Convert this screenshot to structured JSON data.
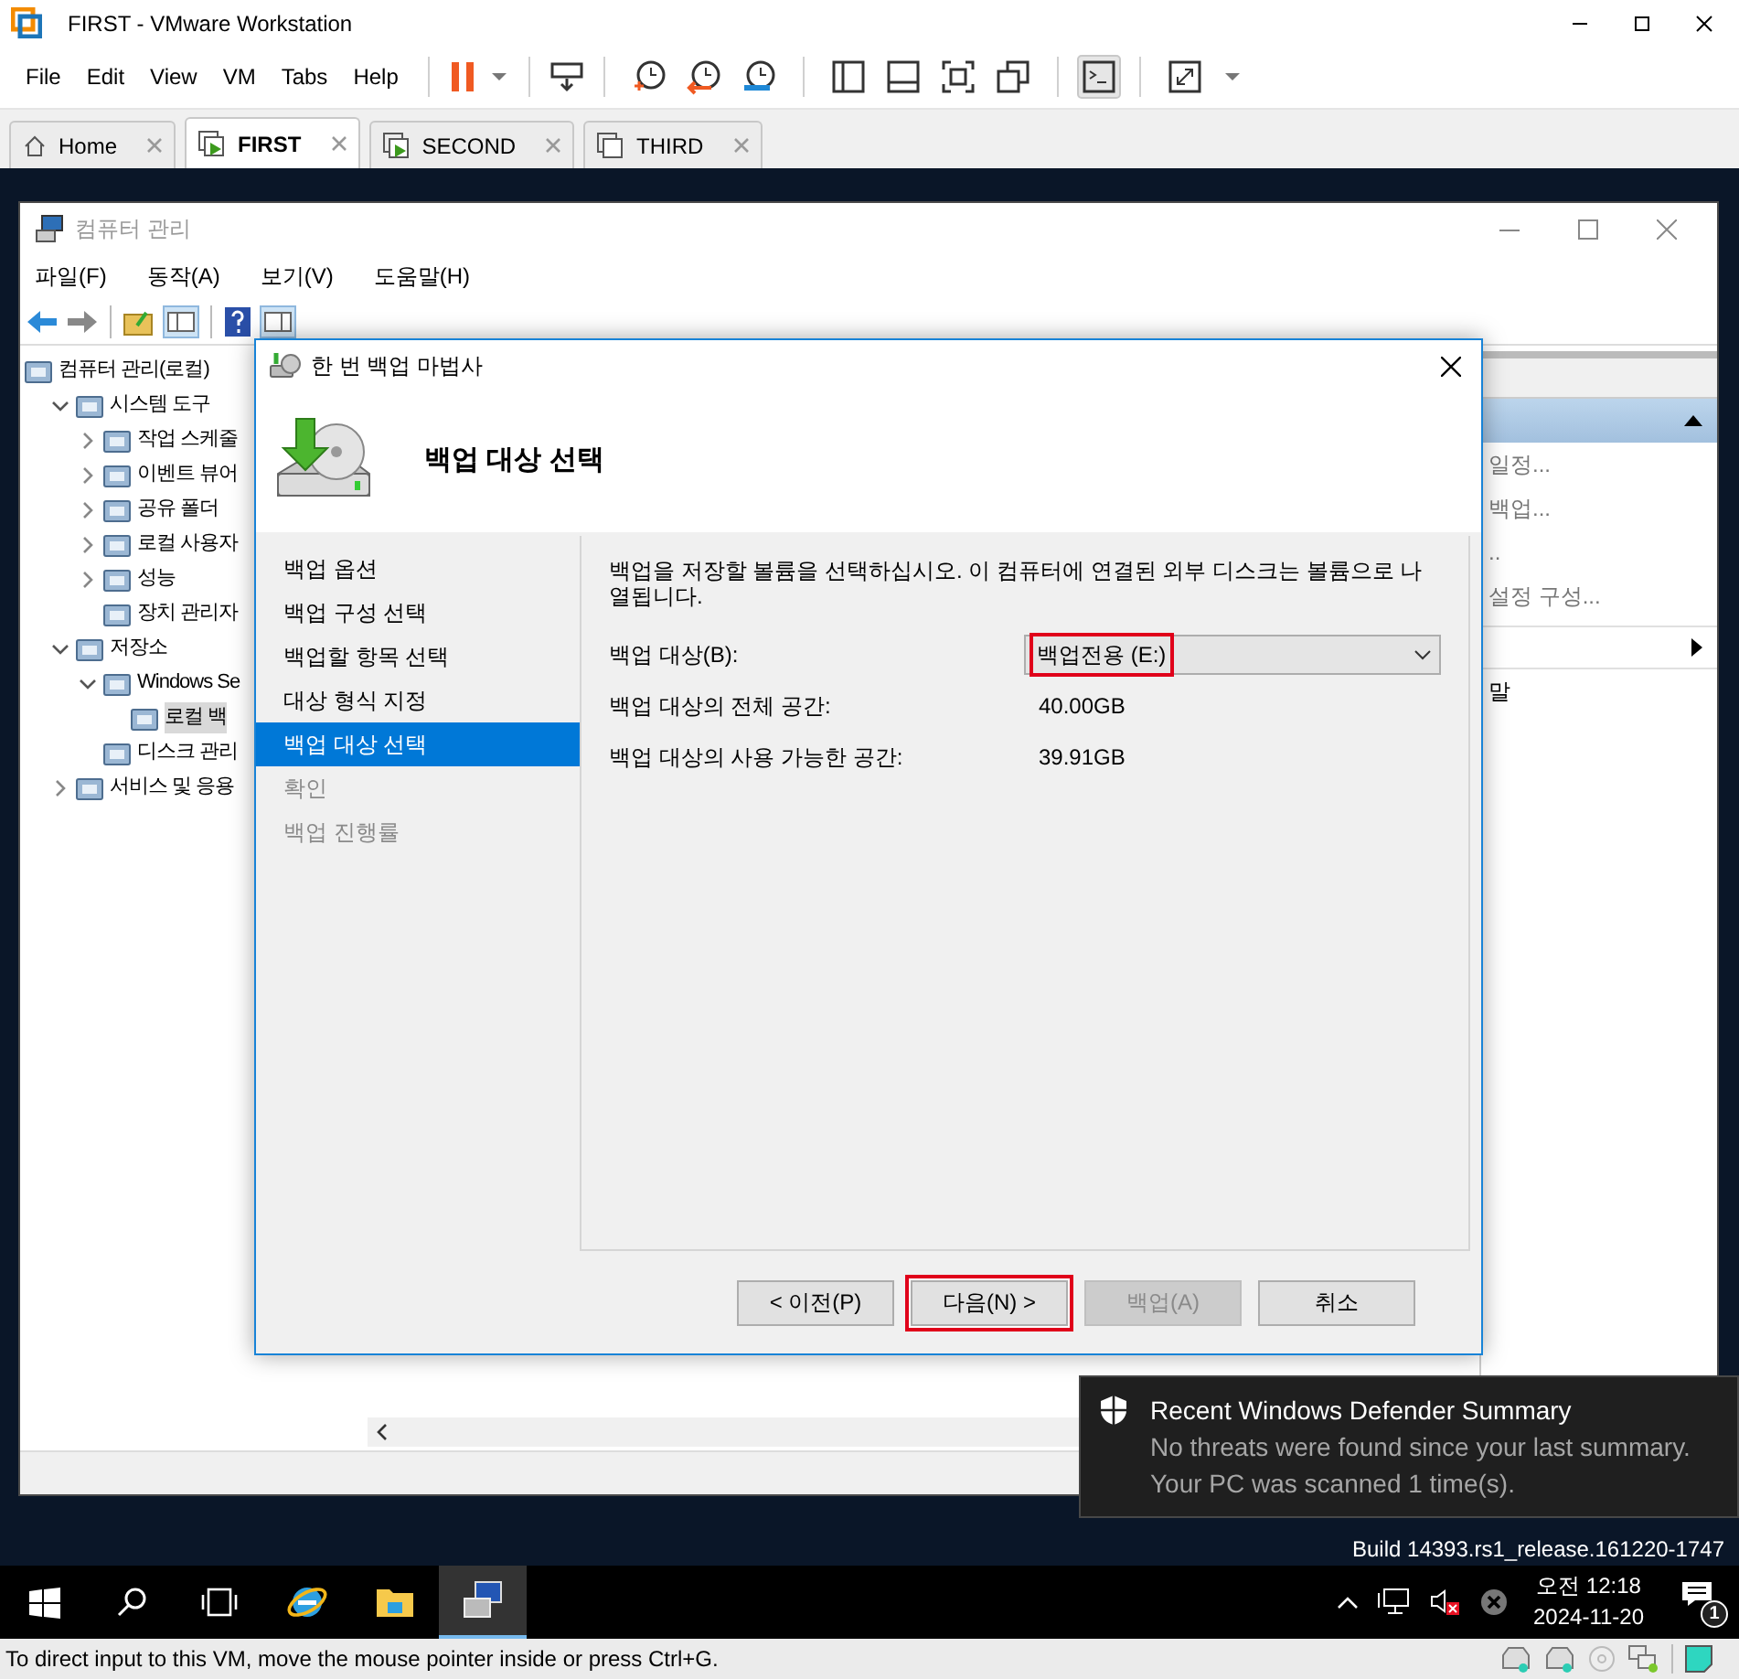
{
  "vmware": {
    "title": "FIRST - VMware Workstation",
    "menu": [
      "File",
      "Edit",
      "View",
      "VM",
      "Tabs",
      "Help"
    ],
    "tabs": [
      {
        "label": "Home",
        "selected": false
      },
      {
        "label": "FIRST",
        "selected": true
      },
      {
        "label": "SECOND",
        "selected": false
      },
      {
        "label": "THIRD",
        "selected": false
      }
    ]
  },
  "guest": {
    "computer_management": {
      "title": "컴퓨터 관리",
      "menu": [
        "파일(F)",
        "동작(A)",
        "보기(V)",
        "도움말(H)"
      ],
      "tree": [
        {
          "label": "컴퓨터 관리(로컬)",
          "selected": false,
          "children": [
            {
              "label": "시스템 도구",
              "selected": false,
              "expanded": true,
              "children": [
                {
                  "label": "작업 스케줄",
                  "selected": false,
                  "expanded": false
                },
                {
                  "label": "이벤트 뷰어",
                  "selected": false,
                  "expanded": false
                },
                {
                  "label": "공유 폴더",
                  "selected": false,
                  "expanded": false
                },
                {
                  "label": "로컬 사용자",
                  "selected": false,
                  "expanded": false
                },
                {
                  "label": "성능",
                  "selected": false,
                  "expanded": false
                },
                {
                  "label": "장치 관리자",
                  "selected": false
                }
              ]
            },
            {
              "label": "저장소",
              "selected": false,
              "expanded": true,
              "children": [
                {
                  "label": "Windows Se",
                  "selected": false,
                  "expanded": true,
                  "children": [
                    {
                      "label": "로컬 백",
                      "selected": true
                    }
                  ]
                },
                {
                  "label": "디스크 관리",
                  "selected": false
                }
              ]
            },
            {
              "label": "서비스 및 응용",
              "selected": false,
              "expanded": false
            }
          ]
        }
      ],
      "actions": [
        {
          "kind": "item",
          "label": "일정...",
          "disabled": true
        },
        {
          "kind": "item",
          "label": "백업...",
          "disabled": true
        },
        {
          "kind": "item",
          "label": "..",
          "disabled": true
        },
        {
          "kind": "item",
          "label": "설정 구성...",
          "disabled": true
        },
        {
          "kind": "submenu"
        },
        {
          "kind": "item",
          "label": "말",
          "disabled": false
        }
      ]
    },
    "wizard": {
      "title": "한 번 백업 마법사",
      "heading": "백업 대상 선택",
      "steps": [
        {
          "label": "백업 옵션",
          "selected": false,
          "disabled": false
        },
        {
          "label": "백업 구성 선택",
          "selected": false,
          "disabled": false
        },
        {
          "label": "백업할 항목 선택",
          "selected": false,
          "disabled": false
        },
        {
          "label": "대상 형식 지정",
          "selected": false,
          "disabled": false
        },
        {
          "label": "백업 대상 선택",
          "selected": true,
          "disabled": false
        },
        {
          "label": "확인",
          "selected": false,
          "disabled": true
        },
        {
          "label": "백업 진행률",
          "selected": false,
          "disabled": true
        }
      ],
      "description": "백업을 저장할 볼륨을 선택하십시오. 이 컴퓨터에 연결된 외부 디스크는 볼륨으로 나열됩니다.",
      "fields": [
        {
          "kind": "dropdown",
          "label": "백업 대상(B):",
          "value": "백업전용 (E:)",
          "highlighted": true
        },
        {
          "kind": "text",
          "label": "백업 대상의 전체 공간:",
          "value": "40.00GB"
        },
        {
          "kind": "text",
          "label": "백업 대상의 사용 가능한 공간:",
          "value": "39.91GB"
        }
      ],
      "buttons": [
        {
          "label": "< 이전(P)",
          "highlighted": false,
          "disabled": false
        },
        {
          "label": "다음(N) >",
          "highlighted": true,
          "disabled": false
        },
        {
          "label": "백업(A)",
          "highlighted": false,
          "disabled": true
        },
        {
          "label": "취소",
          "highlighted": false,
          "disabled": false
        }
      ]
    },
    "notification": {
      "title": "Recent Windows Defender Summary",
      "body": "No threats were found since your last summary. Your PC was scanned 1 time(s)."
    },
    "build": "Build 14393.rs1_release.161220-1747",
    "clock": {
      "time": "오전 12:18",
      "date": "2024-11-20"
    },
    "notification_count": "1"
  },
  "status_bar": "To direct input to this VM, move the mouse pointer inside or press Ctrl+G."
}
